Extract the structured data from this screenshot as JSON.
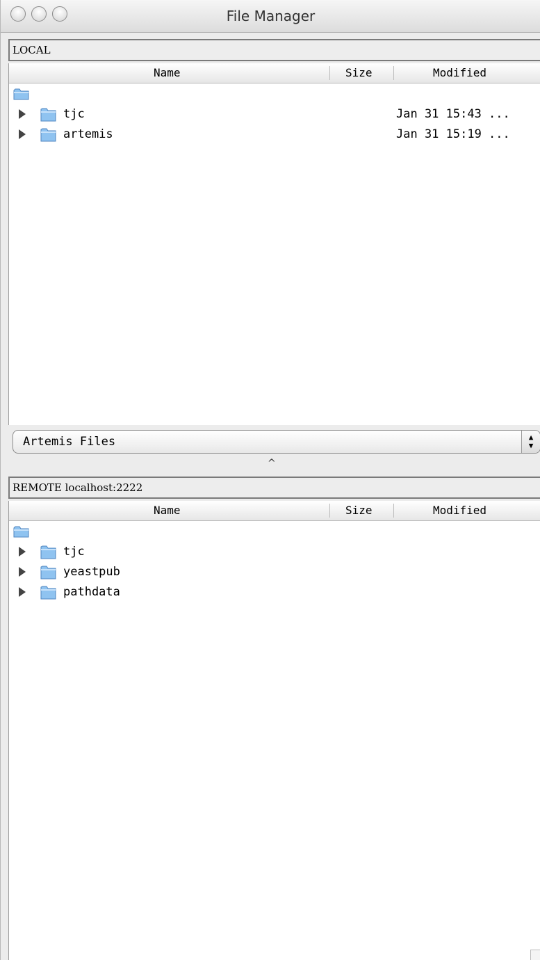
{
  "window": {
    "title": "File Manager"
  },
  "local": {
    "path_label": "LOCAL",
    "columns": {
      "name": "Name",
      "size": "Size",
      "modified": "Modified"
    },
    "rows": [
      {
        "name": "tjc",
        "modified": "Jan 31 15:43 ..."
      },
      {
        "name": "artemis",
        "modified": "Jan 31 15:19 ..."
      }
    ]
  },
  "dropdown": {
    "selected": "Artemis Files"
  },
  "splitter": {
    "glyph": "^"
  },
  "remote": {
    "path_label": "REMOTE localhost:2222",
    "columns": {
      "name": "Name",
      "size": "Size",
      "modified": "Modified"
    },
    "rows": [
      {
        "name": "tjc"
      },
      {
        "name": "yeastpub"
      },
      {
        "name": "pathdata"
      }
    ]
  },
  "icons": {
    "row_icon": "folder-icon",
    "expand": "disclosure-triangle-icon",
    "folder_color": "#8fc3f0"
  }
}
